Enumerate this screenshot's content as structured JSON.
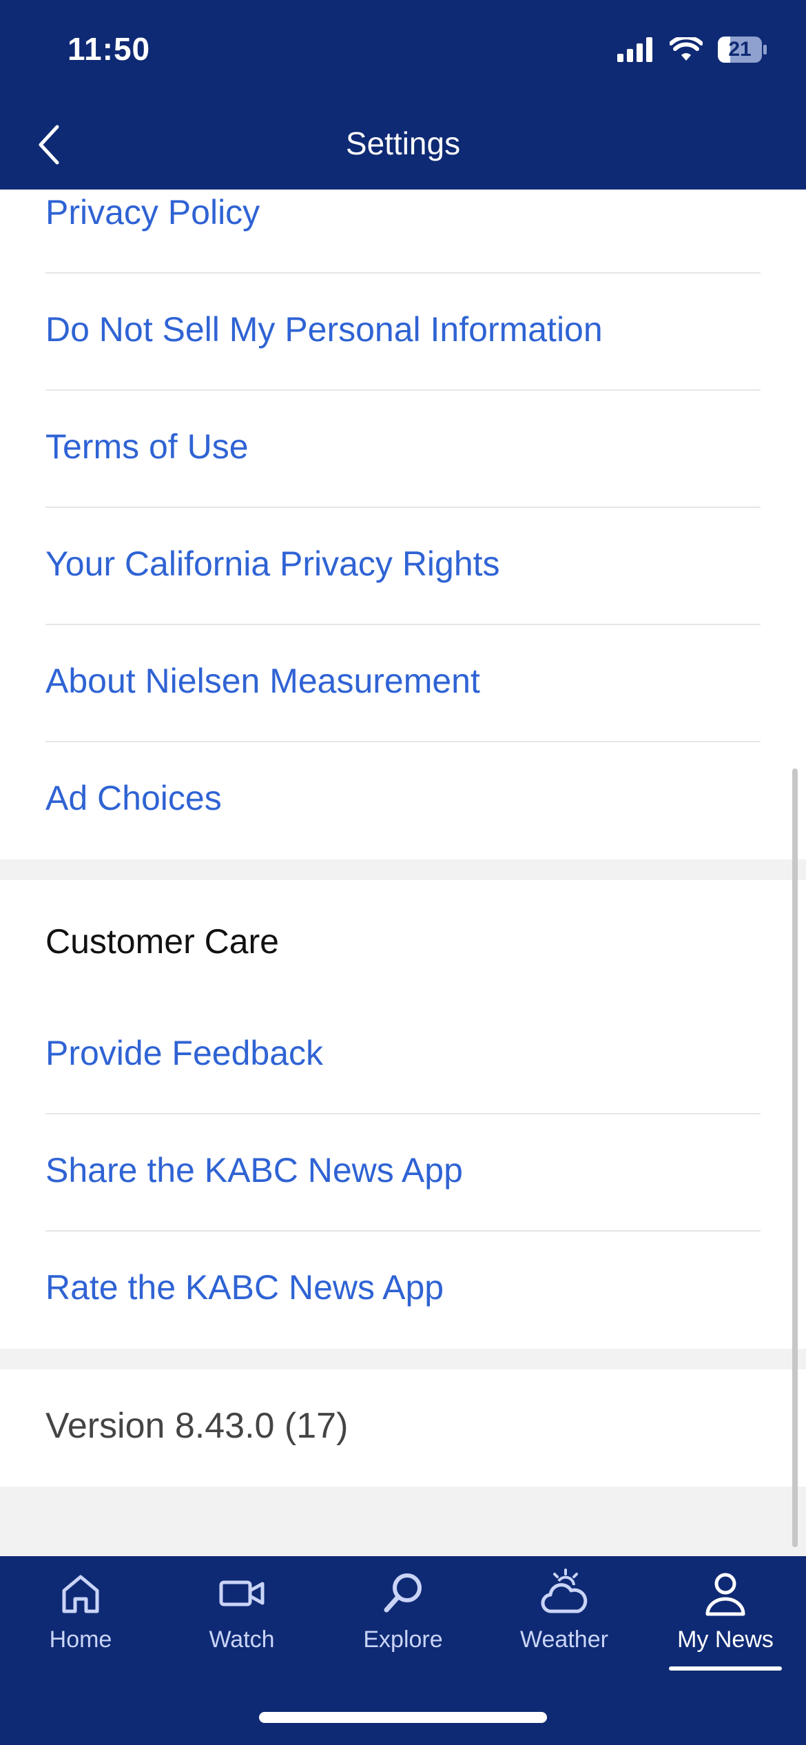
{
  "status_bar": {
    "time": "11:50",
    "battery": "21"
  },
  "nav": {
    "title": "Settings",
    "back_icon": "chevron-left-icon"
  },
  "legal_items": [
    {
      "label": "Privacy Policy"
    },
    {
      "label": "Do Not Sell My Personal Information"
    },
    {
      "label": "Terms of Use"
    },
    {
      "label": "Your California Privacy Rights"
    },
    {
      "label": "About Nielsen Measurement"
    },
    {
      "label": "Ad Choices"
    }
  ],
  "customer_care": {
    "header": "Customer Care",
    "items": [
      {
        "label": "Provide Feedback"
      },
      {
        "label": "Share the KABC News App"
      },
      {
        "label": "Rate the KABC News App"
      }
    ]
  },
  "version": "Version 8.43.0 (17)",
  "tab_bar": {
    "tabs": [
      {
        "label": "Home",
        "icon": "house-icon"
      },
      {
        "label": "Watch",
        "icon": "video-camera-icon"
      },
      {
        "label": "Explore",
        "icon": "search-icon"
      },
      {
        "label": "Weather",
        "icon": "cloud-sun-icon"
      },
      {
        "label": "My News",
        "icon": "person-icon"
      }
    ],
    "active": "My News"
  },
  "colors": {
    "brand_navy": "#0f2a74",
    "link_blue": "#2f63d4",
    "tab_inactive": "#c9d4f7"
  }
}
